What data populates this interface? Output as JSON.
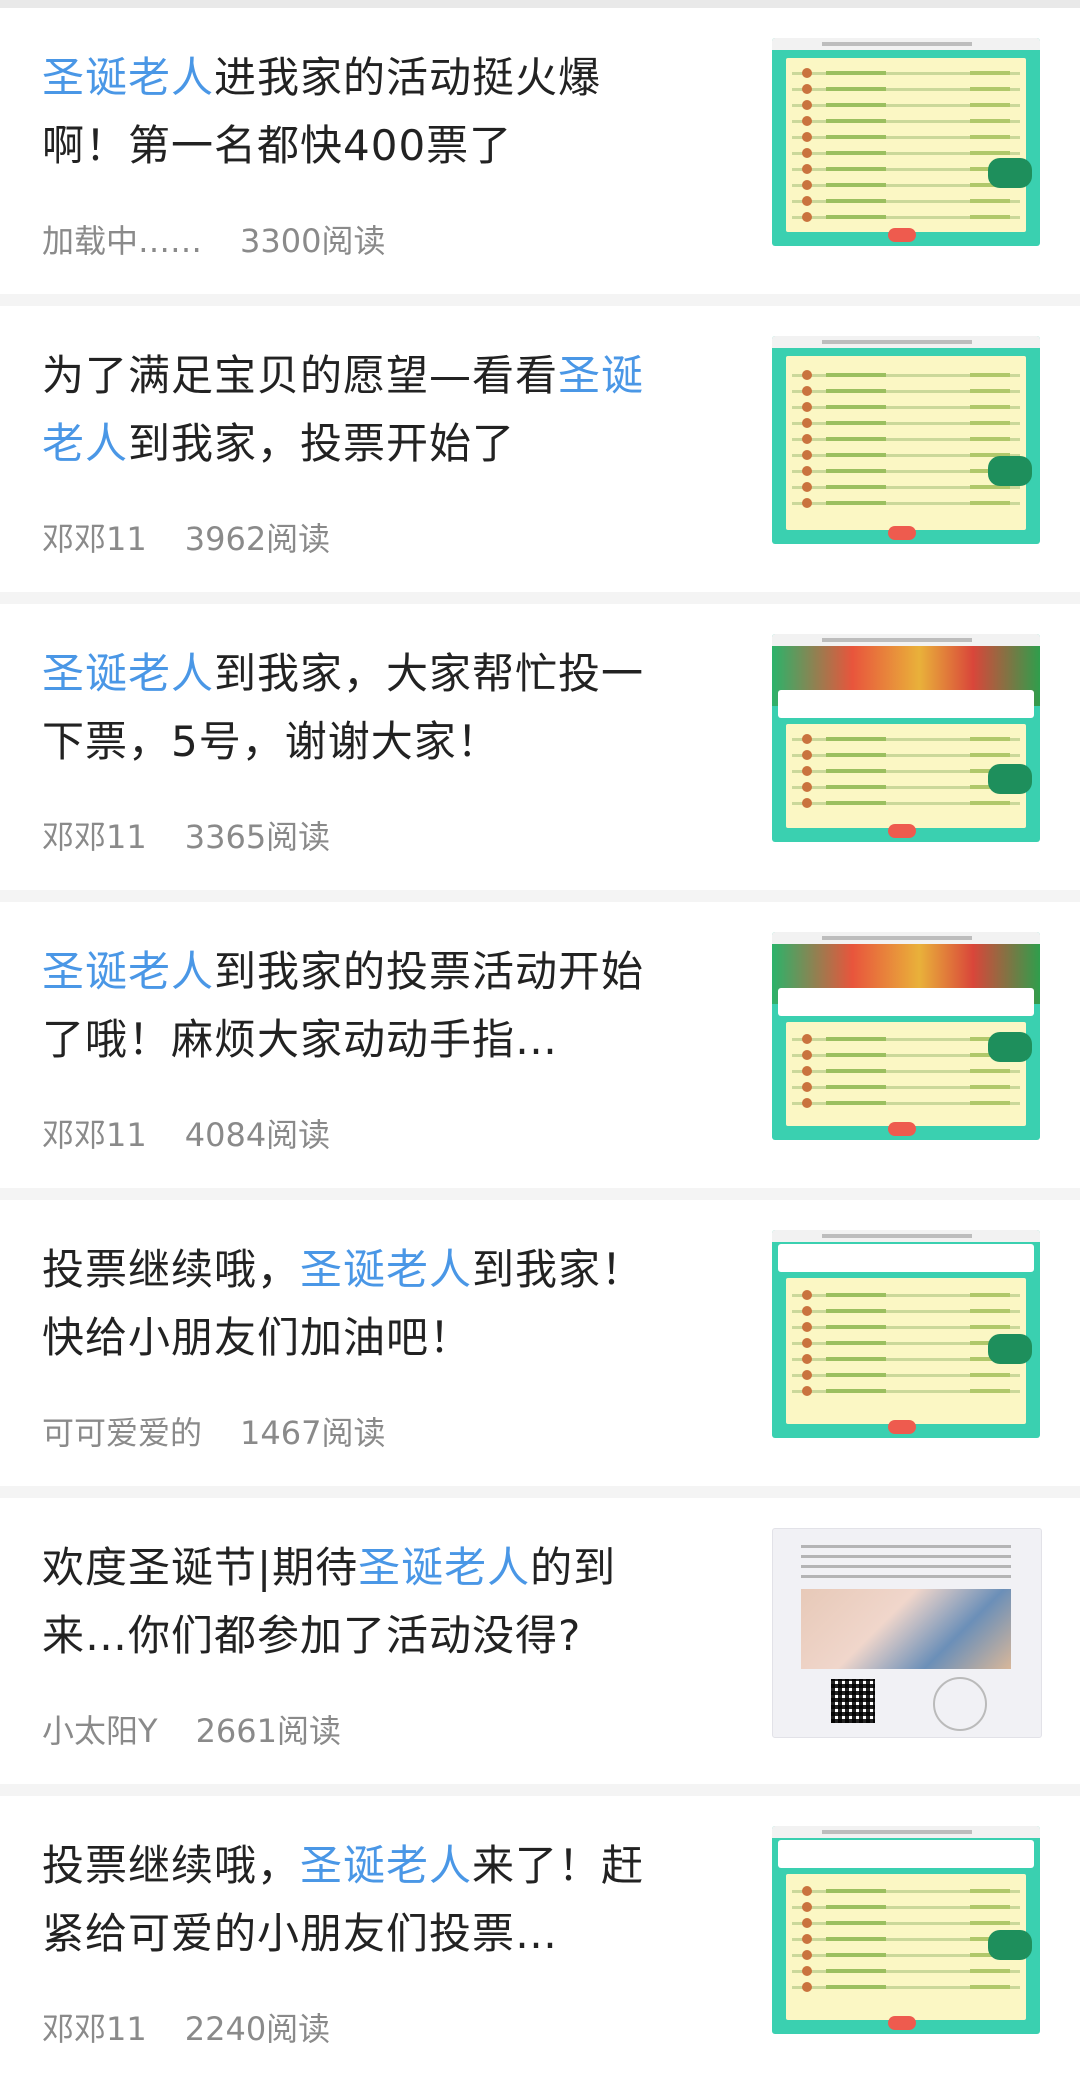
{
  "articles": [
    {
      "title_pre": "",
      "title_hl": "圣诞老人",
      "title_post": "进我家的活动挺火爆啊！第一名都快400票了",
      "author": "加载中……",
      "reads": "3300阅读",
      "thumb": "vote-list-screenshot"
    },
    {
      "title_pre": "为了满足宝贝的愿望—看看",
      "title_hl": "圣诞老人",
      "title_post": "到我家，投票开始了",
      "author": "邓邓11",
      "reads": "3962阅读",
      "thumb": "vote-list-screenshot"
    },
    {
      "title_pre": "",
      "title_hl": "圣诞老人",
      "title_post": "到我家，大家帮忙投一下票，5号，谢谢大家！",
      "author": "邓邓11",
      "reads": "3365阅读",
      "thumb": "vote-banner-screenshot"
    },
    {
      "title_pre": "",
      "title_hl": "圣诞老人",
      "title_post": "到我家的投票活动开始了哦！麻烦大家动动手指…",
      "author": "邓邓11",
      "reads": "4084阅读",
      "thumb": "vote-banner-screenshot"
    },
    {
      "title_pre": "投票继续哦，",
      "title_hl": "圣诞老人",
      "title_post": "到我家！快给小朋友们加油吧！",
      "author": "可可爱爱的",
      "reads": "1467阅读",
      "thumb": "vote-list-screenshot"
    },
    {
      "title_pre": "欢度圣诞节|期待",
      "title_hl": "圣诞老人",
      "title_post": "的到来…你们都参加了活动没得?",
      "author": "小太阳Y",
      "reads": "2661阅读",
      "thumb": "photo-qr-screenshot"
    },
    {
      "title_pre": "投票继续哦，",
      "title_hl": "圣诞老人",
      "title_post": "来了！赶紧给可爱的小朋友们投票…",
      "author": "邓邓11",
      "reads": "2240阅读",
      "thumb": "vote-list-screenshot"
    }
  ],
  "colors": {
    "highlight": "#4a97e6",
    "title": "#222222",
    "meta": "#8a8a8a",
    "background": "#f4f4f4"
  }
}
